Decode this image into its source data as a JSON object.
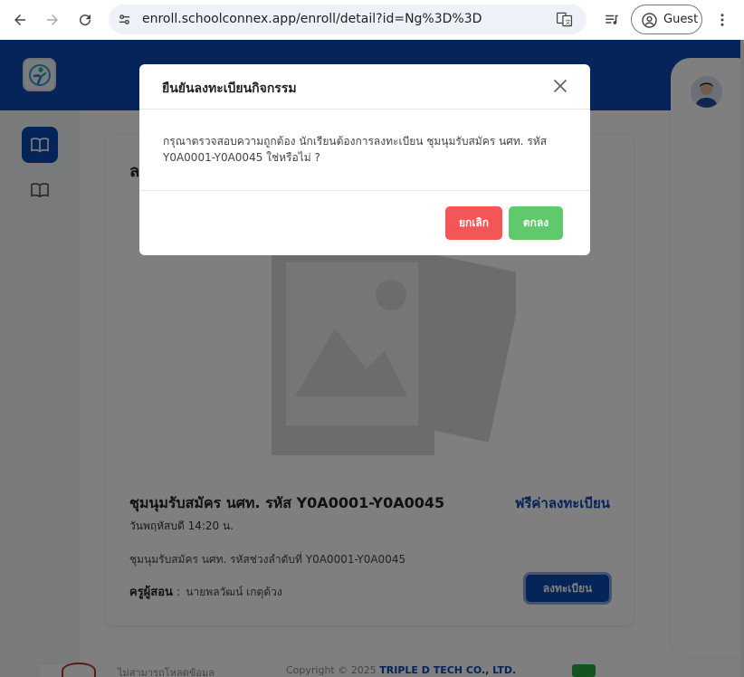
{
  "browser": {
    "url": "enroll.schoolconnex.app/enroll/detail?id=Ng%3D%3D",
    "profile_label": "Guest"
  },
  "card": {
    "heading_peek": "ล",
    "activity_title": "ชุมนุมรับสมัคร นศท. รหัส Y0A0001-Y0A0045",
    "fee_label": "ฟรีค่าลงทะเบียน",
    "date_time": "วันพฤหัสบดี 14:20 น.",
    "description": "ชุมนุมรับสมัคร นศท. รหัสช่วงลำดับที่ Y0A0001-Y0A0045",
    "teacher_label": "ครูผู้สอน",
    "teacher_sep": ":",
    "teacher_name": "นายพลวัฒน์ เกตุด้วง",
    "register_label": "ลงทะเบียน"
  },
  "footer": {
    "left_text": "ไม่สามารถโหลดข้อมูล",
    "copyright": "Copyright © 2025",
    "company": "TRIPLE D TECH CO., LTD."
  },
  "modal": {
    "title": "ยืนยันลงทะเบียนกิจกรรม",
    "message": "กรุณาตรวจสอบความถูกต้อง นักเรียนต้องการลงทะเบียน ชุมนุมรับสมัคร นศท. รหัส Y0A0001-Y0A0045 ใช่หรือไม่ ?",
    "cancel_label": "ยกเลิก",
    "ok_label": "ตกลง"
  },
  "colors": {
    "brand": "#0b48b5",
    "cancel": "#f25656",
    "ok": "#5fc96b"
  },
  "icons": [
    "back-arrow-icon",
    "forward-arrow-icon",
    "reload-icon",
    "site-info-icon",
    "translate-icon",
    "media-icon",
    "account-circle-icon",
    "more-vert-icon",
    "book-icon",
    "close-icon",
    "image-placeholder-icon"
  ]
}
